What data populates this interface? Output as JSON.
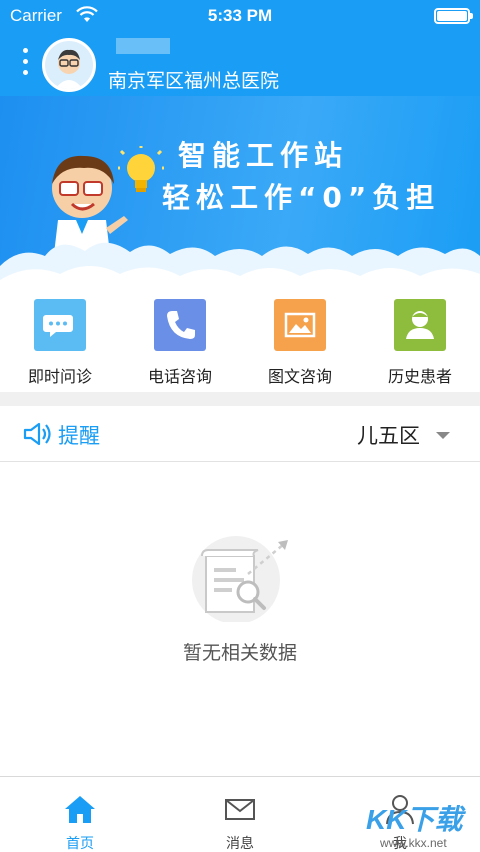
{
  "status_bar": {
    "carrier": "Carrier",
    "time": "5:33 PM"
  },
  "header": {
    "hospital": "南京军区福州总医院"
  },
  "banner": {
    "line1": "智能工作站",
    "line2": "轻松工作“0”负担"
  },
  "actions": [
    {
      "label": "即时问诊",
      "color": "#5bbcf3"
    },
    {
      "label": "电话咨询",
      "color": "#6a8fe6"
    },
    {
      "label": "图文咨询",
      "color": "#f6a14c"
    },
    {
      "label": "历史患者",
      "color": "#8ebc3c"
    }
  ],
  "reminder": {
    "title": "提醒",
    "region": "儿五区"
  },
  "empty": {
    "text": "暂无相关数据"
  },
  "tabbar": {
    "tabs": [
      {
        "label": "首页"
      },
      {
        "label": "消息"
      },
      {
        "label": "我"
      }
    ]
  },
  "watermark": {
    "main": "KK下载",
    "sub": "www.kkx.net"
  },
  "colors": {
    "primary": "#1a9df5"
  }
}
